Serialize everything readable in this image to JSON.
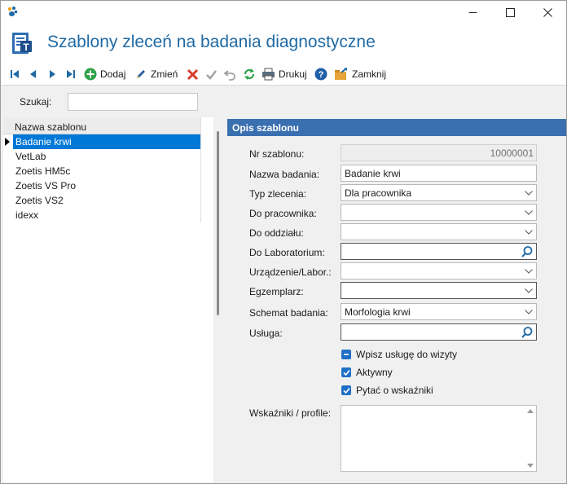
{
  "window": {
    "minimize_icon": "minimize-icon",
    "maximize_icon": "maximize-icon",
    "close_icon": "close-icon"
  },
  "header": {
    "title": "Szablony zleceń na badania diagnostyczne"
  },
  "toolbar": {
    "first_icon": "first-record-icon",
    "prev_icon": "previous-record-icon",
    "next_icon": "next-record-icon",
    "last_icon": "last-record-icon",
    "add_label": "Dodaj",
    "edit_label": "Zmień",
    "print_label": "Drukuj",
    "close_label": "Zamknij"
  },
  "search": {
    "label": "Szukaj:",
    "value": ""
  },
  "list": {
    "column_header": "Nazwa szablonu",
    "items": [
      {
        "label": "Badanie krwi",
        "selected": true
      },
      {
        "label": "VetLab",
        "selected": false
      },
      {
        "label": "Zoetis HM5c",
        "selected": false
      },
      {
        "label": "Zoetis VS Pro",
        "selected": false
      },
      {
        "label": "Zoetis VS2",
        "selected": false
      },
      {
        "label": "idexx",
        "selected": false
      }
    ]
  },
  "details": {
    "section_title": "Opis szablonu",
    "fields": {
      "nr_szablonu": {
        "label": "Nr szablonu:",
        "value": "10000001"
      },
      "nazwa_badania": {
        "label": "Nazwa badania:",
        "value": "Badanie krwi"
      },
      "typ_zlecenia": {
        "label": "Typ zlecenia:",
        "value": "Dla pracownika"
      },
      "do_pracownika": {
        "label": "Do pracownika:",
        "value": ""
      },
      "do_oddzialu": {
        "label": "Do oddziału:",
        "value": ""
      },
      "do_laboratorium": {
        "label": "Do Laboratorium:",
        "value": ""
      },
      "urzadzenie": {
        "label": "Urządzenie/Labor.:",
        "value": ""
      },
      "egzemplarz": {
        "label": "Egzemplarz:",
        "value": ""
      },
      "schemat_badania": {
        "label": "Schemat badania:",
        "value": "Morfologia krwi"
      },
      "usluga": {
        "label": "Usługa:",
        "value": ""
      }
    },
    "checkboxes": {
      "wpisz_usluge": {
        "label": "Wpisz usługę do wizyty",
        "state": "indeterminate"
      },
      "aktywny": {
        "label": "Aktywny",
        "state": "checked"
      },
      "pytac": {
        "label": "Pytać o wskaźniki",
        "state": "checked"
      }
    },
    "wskazniki": {
      "label": "Wskaźniki / profile:",
      "value": ""
    }
  },
  "colors": {
    "accent": "#1f6aa5",
    "selection": "#0078d7",
    "section_header": "#3a6fb0",
    "checkbox": "#1f6fc5"
  }
}
